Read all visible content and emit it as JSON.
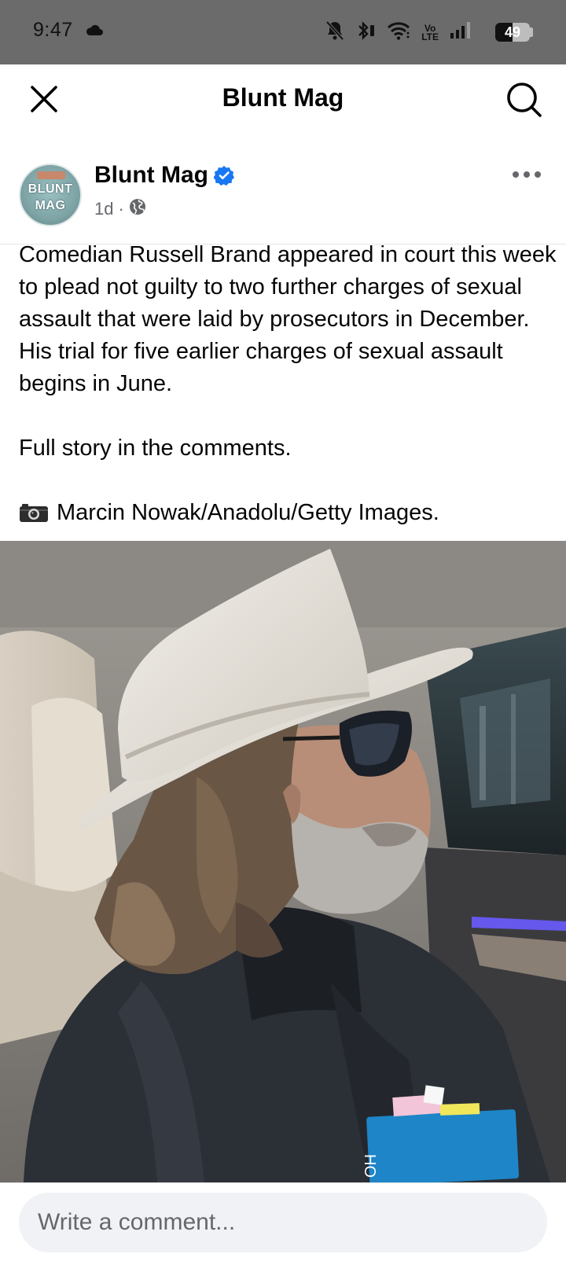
{
  "status_bar": {
    "time": "9:47",
    "battery_text": "49",
    "battery_level": 0.49,
    "network_label_top": "Vo",
    "network_label_bottom": "LTE"
  },
  "header": {
    "title": "Blunt Mag"
  },
  "post": {
    "page_name": "Blunt Mag",
    "avatar_line1": "BLUNT",
    "avatar_line2": "MAG",
    "time_ago": "1d",
    "separator": "·",
    "body_paragraph": "Comedian Russell Brand appeared in court this week to plead not guilty to two further charges of sexual assault that were laid by prosecutors in December. His trial for five earlier charges of sexual assault begins in June.",
    "cta_text": "Full story in the comments.",
    "credit_text": "Marcin Nowak/Anadolu/Getty Images.",
    "photo_folder_text": "HO"
  },
  "comment": {
    "placeholder": "Write a comment..."
  },
  "colors": {
    "status_bar_bg": "#6b6b6b",
    "verified_blue": "#1877f2",
    "meta_gray": "#65676b",
    "input_bg": "#f0f2f5"
  }
}
